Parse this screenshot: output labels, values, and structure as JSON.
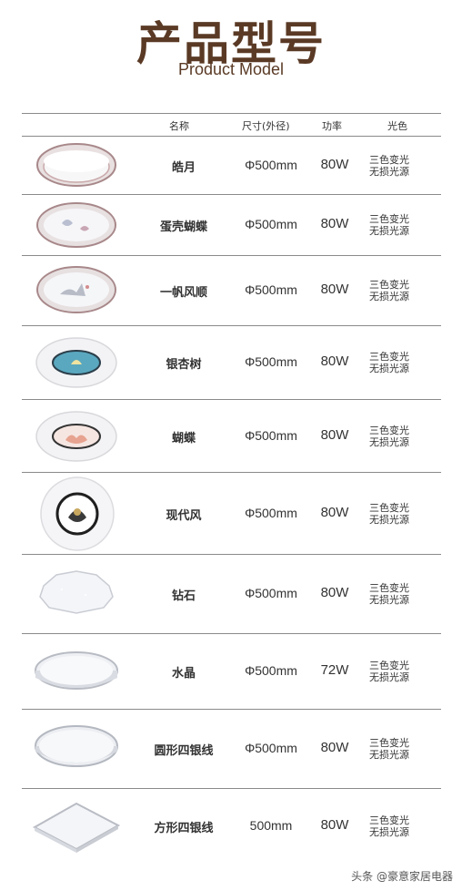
{
  "header": {
    "title_cn": "产品型号",
    "title_en": "Product Model"
  },
  "table": {
    "columns": {
      "name": "名称",
      "size": "尺寸(外径)",
      "power": "功率",
      "light": "光色"
    },
    "rows": [
      {
        "name": "皓月",
        "size": "Φ500mm",
        "power": "80W",
        "light1": "三色变光",
        "light2": "无损光源",
        "icon": "round-lamp-plain-icon"
      },
      {
        "name": "蛋壳蝴蝶",
        "size": "Φ500mm",
        "power": "80W",
        "light1": "三色变光",
        "light2": "无损光源",
        "icon": "round-lamp-butterfly-icon"
      },
      {
        "name": "一帆风顺",
        "size": "Φ500mm",
        "power": "80W",
        "light1": "三色变光",
        "light2": "无损光源",
        "icon": "round-lamp-sailboat-icon"
      },
      {
        "name": "银杏树",
        "size": "Φ500mm",
        "power": "80W",
        "light1": "三色变光",
        "light2": "无损光源",
        "icon": "round-lamp-ginkgo-icon"
      },
      {
        "name": "蝴蝶",
        "size": "Φ500mm",
        "power": "80W",
        "light1": "三色变光",
        "light2": "无损光源",
        "icon": "round-lamp-pink-butterfly-icon"
      },
      {
        "name": "现代风",
        "size": "Φ500mm",
        "power": "80W",
        "light1": "三色变光",
        "light2": "无损光源",
        "icon": "round-lamp-modern-icon"
      },
      {
        "name": "钻石",
        "size": "Φ500mm",
        "power": "80W",
        "light1": "三色变光",
        "light2": "无损光源",
        "icon": "diamond-lamp-icon"
      },
      {
        "name": "水晶",
        "size": "Φ500mm",
        "power": "72W",
        "light1": "三色变光",
        "light2": "无损光源",
        "icon": "crystal-lamp-icon"
      },
      {
        "name": "圆形四银线",
        "size": "Φ500mm",
        "power": "80W",
        "light1": "三色变光",
        "light2": "无损光源",
        "icon": "round-silver-line-lamp-icon"
      },
      {
        "name": "方形四银线",
        "size": "500mm",
        "power": "80W",
        "light1": "三色变光",
        "light2": "无损光源",
        "icon": "square-silver-line-lamp-icon"
      }
    ]
  },
  "watermark": "头条 @豪意家居电器"
}
